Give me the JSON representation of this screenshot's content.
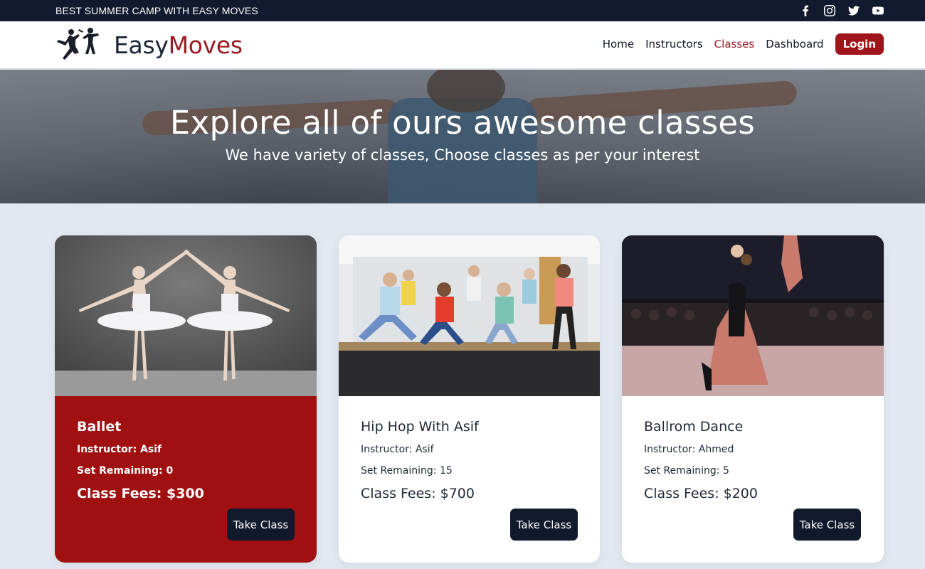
{
  "topbar": {
    "tagline": "BEST SUMMER CAMP WITH EASY MOVES",
    "socials": [
      "facebook-icon",
      "instagram-icon",
      "twitter-icon",
      "youtube-icon"
    ]
  },
  "brand": {
    "part1": "Easy",
    "part2": "Moves"
  },
  "nav": {
    "items": [
      {
        "label": "Home",
        "active": false
      },
      {
        "label": "Instructors",
        "active": false
      },
      {
        "label": "Classes",
        "active": true
      },
      {
        "label": "Dashboard",
        "active": false
      }
    ],
    "login": "Login"
  },
  "hero": {
    "title": "Explore all of ours awesome classes",
    "subtitle": "We have variety of classes, Choose classes as per your interest"
  },
  "classes": [
    {
      "name": "Ballet",
      "instructor": "Instructor: Asif",
      "seats": "Set Remaining: 0",
      "fees": "Class Fees: $300",
      "button": "Take Class",
      "highlight": true
    },
    {
      "name": "Hip Hop With Asif",
      "instructor": "Instructor: Asif",
      "seats": "Set Remaining: 15",
      "fees": "Class Fees: $700",
      "button": "Take Class",
      "highlight": false
    },
    {
      "name": "Ballrom Dance",
      "instructor": "Instructor: Ahmed",
      "seats": "Set Remaining: 5",
      "fees": "Class Fees: $200",
      "button": "Take Class",
      "highlight": false
    }
  ],
  "colors": {
    "accent": "#9b1b22",
    "dark": "#121a2f",
    "highlight_card": "#a01010"
  }
}
